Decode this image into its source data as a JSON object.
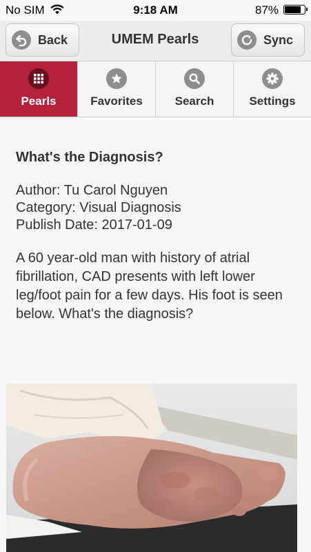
{
  "status_bar": {
    "carrier": "No SIM",
    "time": "9:18 AM",
    "battery_percent": "87%",
    "battery_level": 0.87
  },
  "nav": {
    "back_label": "Back",
    "title": "UMEM Pearls",
    "sync_label": "Sync"
  },
  "tabs": [
    {
      "label": "Pearls",
      "icon": "grid-icon",
      "active": true
    },
    {
      "label": "Favorites",
      "icon": "star-icon",
      "active": false
    },
    {
      "label": "Search",
      "icon": "search-icon",
      "active": false
    },
    {
      "label": "Settings",
      "icon": "gear-icon",
      "active": false
    }
  ],
  "pearl": {
    "title": "What's the Diagnosis?",
    "author": "Author: Tu Carol Nguyen",
    "category": "Category: Visual Diagnosis",
    "publish_date": "Publish Date: 2017-01-09",
    "body": "A 60 year-old man with history of atrial fibrillation, CAD presents with left lower leg/foot pain for a few days. His foot is seen below. What's the diagnosis?"
  },
  "colors": {
    "active_tab": "#b3223a",
    "icon_gray": "#8e8e8e"
  }
}
